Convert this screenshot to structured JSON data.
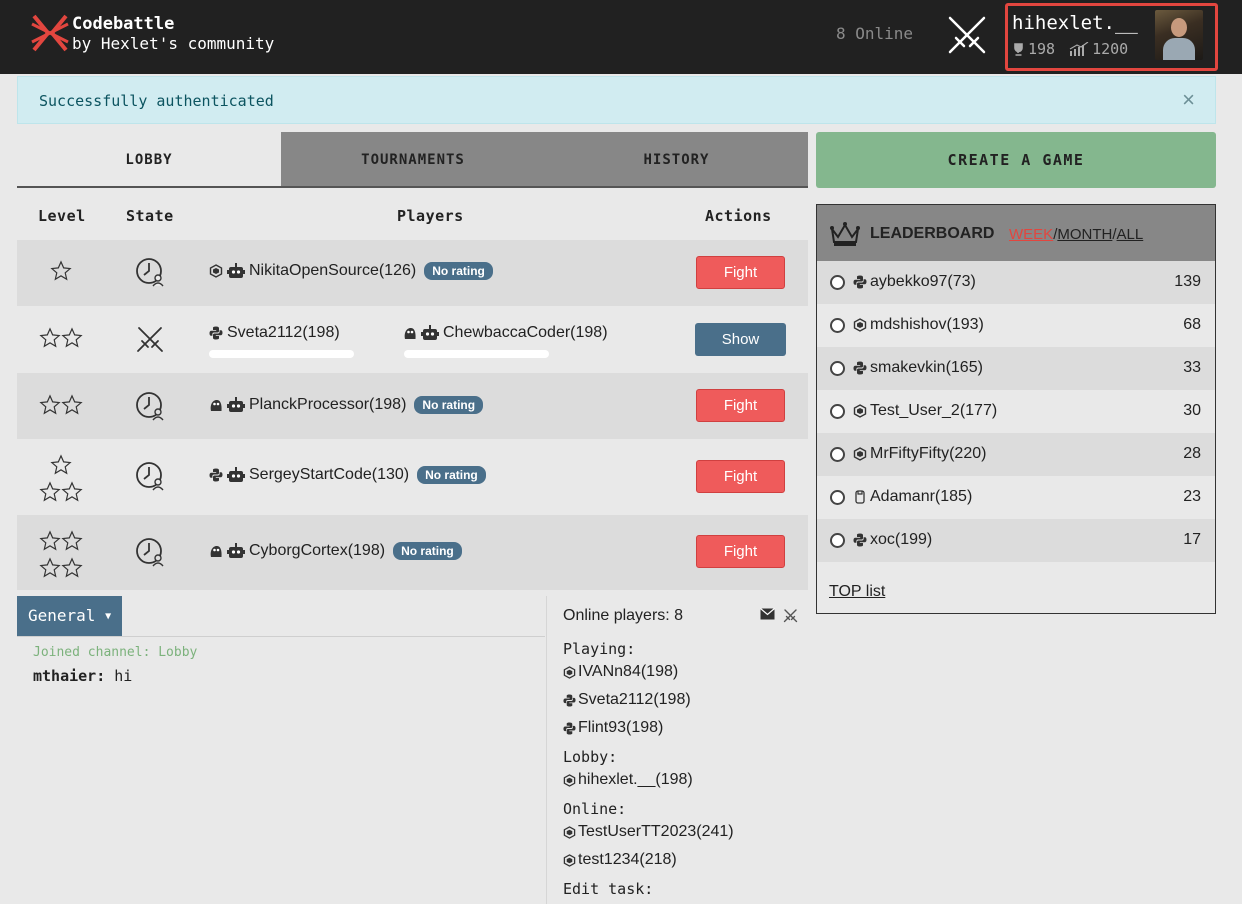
{
  "header": {
    "brand_line1": "Codebattle",
    "brand_line2": "by Hexlet's community",
    "online_count": "8 Online",
    "user": {
      "name": "hihexlet.__",
      "trophies": "198",
      "rating": "1200"
    }
  },
  "alert": {
    "text": "Successfully authenticated",
    "close": "×"
  },
  "tabs": [
    "LOBBY",
    "TOURNAMENTS",
    "HISTORY"
  ],
  "table": {
    "headers": {
      "level": "Level",
      "state": "State",
      "players": "Players",
      "actions": "Actions"
    },
    "rows": [
      {
        "level_stars": 1,
        "state": "waiting",
        "players": [
          {
            "lang": "elixir",
            "bot": true,
            "name": "NikitaOpenSource(126)",
            "badge": "No rating"
          }
        ],
        "action": "Fight"
      },
      {
        "level_stars": 2,
        "state": "playing",
        "players": [
          {
            "lang": "python",
            "bot": false,
            "name": "Sveta2112(198)"
          },
          {
            "lang": "go",
            "bot": true,
            "name": "ChewbaccaCoder(198)"
          }
        ],
        "action": "Show"
      },
      {
        "level_stars": 2,
        "state": "waiting",
        "players": [
          {
            "lang": "go",
            "bot": true,
            "name": "PlanckProcessor(198)",
            "badge": "No rating"
          }
        ],
        "action": "Fight"
      },
      {
        "level_stars": 3,
        "state": "waiting",
        "players": [
          {
            "lang": "python",
            "bot": true,
            "name": "SergeyStartCode(130)",
            "badge": "No rating"
          }
        ],
        "action": "Fight"
      },
      {
        "level_stars": 4,
        "state": "waiting",
        "players": [
          {
            "lang": "go",
            "bot": true,
            "name": "CyborgCortex(198)",
            "badge": "No rating"
          }
        ],
        "action": "Fight"
      }
    ]
  },
  "chat": {
    "channel_button": "General",
    "joined": "Joined channel: Lobby",
    "messages": [
      {
        "author": "mthaier:",
        "text": "hi"
      }
    ]
  },
  "online": {
    "title": "Online players: 8",
    "sections": {
      "playing": "Playing:",
      "lobby": "Lobby:",
      "online": "Online:",
      "edit_task": "Edit task:"
    },
    "playing": [
      {
        "lang": "elixir",
        "name": "IVANn84(198)"
      },
      {
        "lang": "python",
        "name": "Sveta2112(198)"
      },
      {
        "lang": "python",
        "name": "Flint93(198)"
      }
    ],
    "lobby": [
      {
        "lang": "elixir",
        "name": "hihexlet.__(198)"
      }
    ],
    "online": [
      {
        "lang": "elixir",
        "name": "TestUserTT2023(241)"
      },
      {
        "lang": "elixir",
        "name": "test1234(218)"
      }
    ]
  },
  "create_game": "CREATE A GAME",
  "leaderboard": {
    "title": "LEADERBOARD",
    "periods": [
      "WEEK",
      "MONTH",
      "ALL"
    ],
    "active_period": "WEEK",
    "rows": [
      {
        "lang": "python",
        "name": "aybekko97(73)",
        "score": "139"
      },
      {
        "lang": "elixir",
        "name": "mdshishov(193)",
        "score": "68"
      },
      {
        "lang": "python",
        "name": "smakevkin(165)",
        "score": "33"
      },
      {
        "lang": "elixir",
        "name": "Test_User_2(177)",
        "score": "30"
      },
      {
        "lang": "elixir",
        "name": "MrFiftyFifty(220)",
        "score": "28"
      },
      {
        "lang": "clojure",
        "name": "Adamanr(185)",
        "score": "23"
      },
      {
        "lang": "python",
        "name": "xoc(199)",
        "score": "17"
      }
    ],
    "top_list": "TOP list"
  },
  "colors": {
    "header_bg": "#212121",
    "accent_red": "#e2463f",
    "fight": "#ef5b5b",
    "show": "#4a6f8a",
    "create": "#84b78e",
    "alert_bg": "#d1ecf1"
  }
}
